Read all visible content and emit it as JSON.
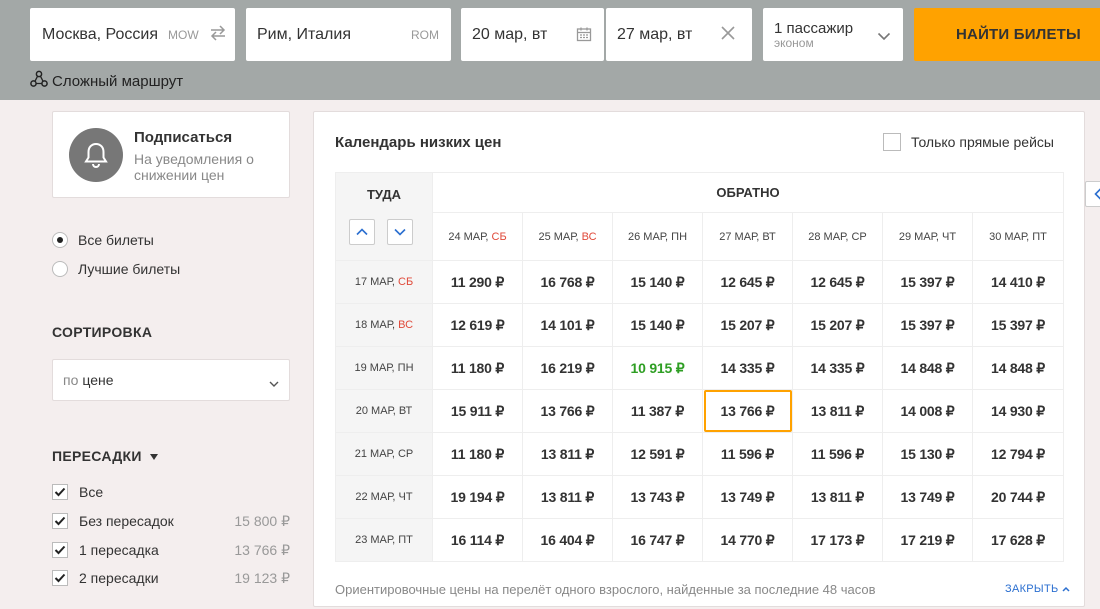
{
  "search": {
    "from_value": "Москва, Россия",
    "from_code": "MOW",
    "to_value": "Рим, Италия",
    "to_code": "ROM",
    "depart_date": "20 мар, вт",
    "return_date": "27 мар, вт",
    "passengers": "1 пассажир",
    "cabin_class": "эконом",
    "search_button": "НАЙТИ БИЛЕТЫ",
    "complex_route": "Сложный маршрут"
  },
  "subscribe": {
    "title": "Подписаться",
    "text": "На уведомления о снижении цен"
  },
  "filter_type": {
    "options": [
      {
        "label": "Все билеты",
        "selected": true
      },
      {
        "label": "Лучшие билеты",
        "selected": false
      }
    ]
  },
  "sort": {
    "title": "СОРТИРОВКА",
    "prefix": "по",
    "value": "цене"
  },
  "stops": {
    "title": "ПЕРЕСАДКИ",
    "items": [
      {
        "label": "Все",
        "checked": true,
        "price": ""
      },
      {
        "label": "Без пересадок",
        "checked": true,
        "price": "15 800 ₽"
      },
      {
        "label": "1 пересадка",
        "checked": true,
        "price": "13 766 ₽"
      },
      {
        "label": "2 пересадки",
        "checked": true,
        "price": "19 123 ₽"
      }
    ]
  },
  "calendar": {
    "title": "Календарь низких цен",
    "direct_only": "Только прямые рейсы",
    "depart_header": "ТУДА",
    "return_header": "ОБРАТНО",
    "return_dates": [
      {
        "date": "24 МАР,",
        "dow": "СБ",
        "weekend": true
      },
      {
        "date": "25 МАР,",
        "dow": "ВС",
        "weekend": true
      },
      {
        "date": "26 МАР,",
        "dow": "ПН",
        "weekend": false
      },
      {
        "date": "27 МАР,",
        "dow": "ВТ",
        "weekend": false
      },
      {
        "date": "28 МАР,",
        "dow": "СР",
        "weekend": false
      },
      {
        "date": "29 МАР,",
        "dow": "ЧТ",
        "weekend": false
      },
      {
        "date": "30 МАР,",
        "dow": "ПТ",
        "weekend": false
      }
    ],
    "rows": [
      {
        "date": "17 МАР,",
        "dow": "СБ",
        "weekend": true,
        "prices": [
          "11 290 ₽",
          "16 768 ₽",
          "15 140 ₽",
          "12 645 ₽",
          "12 645 ₽",
          "15 397 ₽",
          "14 410 ₽"
        ]
      },
      {
        "date": "18 МАР,",
        "dow": "ВС",
        "weekend": true,
        "prices": [
          "12 619 ₽",
          "14 101 ₽",
          "15 140 ₽",
          "15 207 ₽",
          "15 207 ₽",
          "15 397 ₽",
          "15 397 ₽"
        ]
      },
      {
        "date": "19 МАР,",
        "dow": "ПН",
        "weekend": false,
        "prices": [
          "11 180 ₽",
          "16 219 ₽",
          "10 915 ₽",
          "14 335 ₽",
          "14 335 ₽",
          "14 848 ₽",
          "14 848 ₽"
        ]
      },
      {
        "date": "20 МАР,",
        "dow": "ВТ",
        "weekend": false,
        "prices": [
          "15 911 ₽",
          "13 766 ₽",
          "11 387 ₽",
          "13 766 ₽",
          "13 811 ₽",
          "14 008 ₽",
          "14 930 ₽"
        ]
      },
      {
        "date": "21 МАР,",
        "dow": "СР",
        "weekend": false,
        "prices": [
          "11 180 ₽",
          "13 811 ₽",
          "12 591 ₽",
          "11 596 ₽",
          "11 596 ₽",
          "15 130 ₽",
          "12 794 ₽"
        ]
      },
      {
        "date": "22 МАР,",
        "dow": "ЧТ",
        "weekend": false,
        "prices": [
          "19 194 ₽",
          "13 811 ₽",
          "13 743 ₽",
          "13 749 ₽",
          "13 811 ₽",
          "13 749 ₽",
          "20 744 ₽"
        ]
      },
      {
        "date": "23 МАР,",
        "dow": "ПТ",
        "weekend": false,
        "prices": [
          "16 114 ₽",
          "16 404 ₽",
          "16 747 ₽",
          "14 770 ₽",
          "17 173 ₽",
          "17 219 ₽",
          "17 628 ₽"
        ]
      }
    ],
    "cheapest": {
      "row": 2,
      "col": 2
    },
    "selected": {
      "row": 3,
      "col": 3
    },
    "note": "Ориентировочные цены на перелёт одного взрослого, найденные за последние 48 часов",
    "close_label": "ЗАКРЫТЬ"
  },
  "colors": {
    "accent": "#ffa200",
    "weekend": "#e04a3a",
    "cheapest": "#2e9e23",
    "link": "#2b6fd0",
    "header_bg": "#a3a8a7"
  }
}
